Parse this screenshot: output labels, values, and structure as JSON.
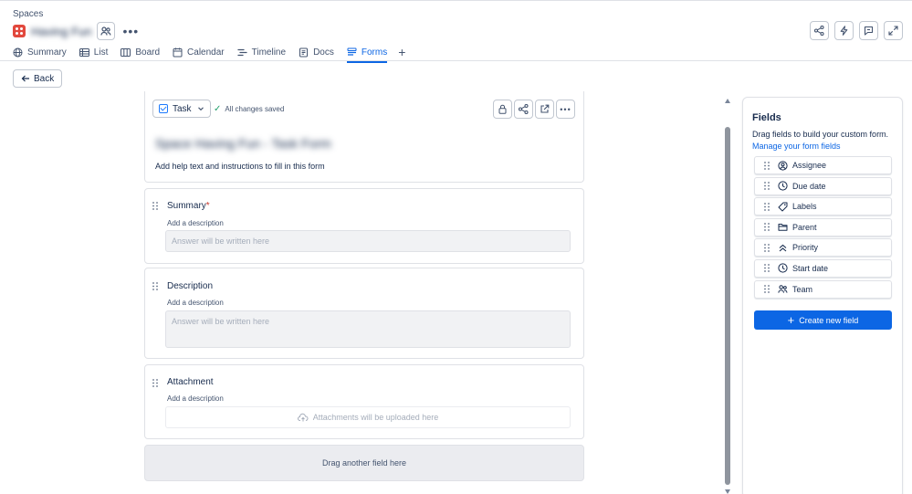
{
  "breadcrumb": "Spaces",
  "space": {
    "name": "Having Fun",
    "logo_color": "#e2483d"
  },
  "tabs": [
    {
      "label": "Summary",
      "icon": "globe-icon",
      "active": false
    },
    {
      "label": "List",
      "icon": "list-icon",
      "active": false
    },
    {
      "label": "Board",
      "icon": "board-icon",
      "active": false
    },
    {
      "label": "Calendar",
      "icon": "calendar-icon",
      "active": false
    },
    {
      "label": "Timeline",
      "icon": "timeline-icon",
      "active": false
    },
    {
      "label": "Docs",
      "icon": "docs-icon",
      "active": false
    },
    {
      "label": "Forms",
      "icon": "forms-icon",
      "active": true
    }
  ],
  "back_label": "Back",
  "form": {
    "work_type": "Task",
    "save_status": "All changes saved",
    "title": "Space Having Fun - Task Form",
    "help_text": "Add help text and instructions to fill in this form",
    "fields": [
      {
        "label": "Summary",
        "required": "*",
        "description": "Add a description",
        "placeholder": "Answer will be written here"
      },
      {
        "label": "Description",
        "description": "Add a description",
        "placeholder": "Answer will be written here"
      },
      {
        "label": "Attachment",
        "description": "Add a description",
        "placeholder": "Attachments will be uploaded here"
      }
    ],
    "drop_zone": "Drag another field here"
  },
  "fields_panel": {
    "title": "Fields",
    "description": "Drag fields to build your custom form.",
    "manage_link": "Manage your form fields",
    "items": [
      {
        "label": "Assignee",
        "icon": "person-circle-icon"
      },
      {
        "label": "Due date",
        "icon": "clock-icon"
      },
      {
        "label": "Labels",
        "icon": "tag-icon"
      },
      {
        "label": "Parent",
        "icon": "folder-icon"
      },
      {
        "label": "Priority",
        "icon": "priority-icon"
      },
      {
        "label": "Start date",
        "icon": "clock-icon"
      },
      {
        "label": "Team",
        "icon": "people-icon"
      }
    ],
    "create_label": "Create new field"
  },
  "colors": {
    "accent": "#0c66e4",
    "required": "#c9372c",
    "saved_check": "#22a06b"
  }
}
